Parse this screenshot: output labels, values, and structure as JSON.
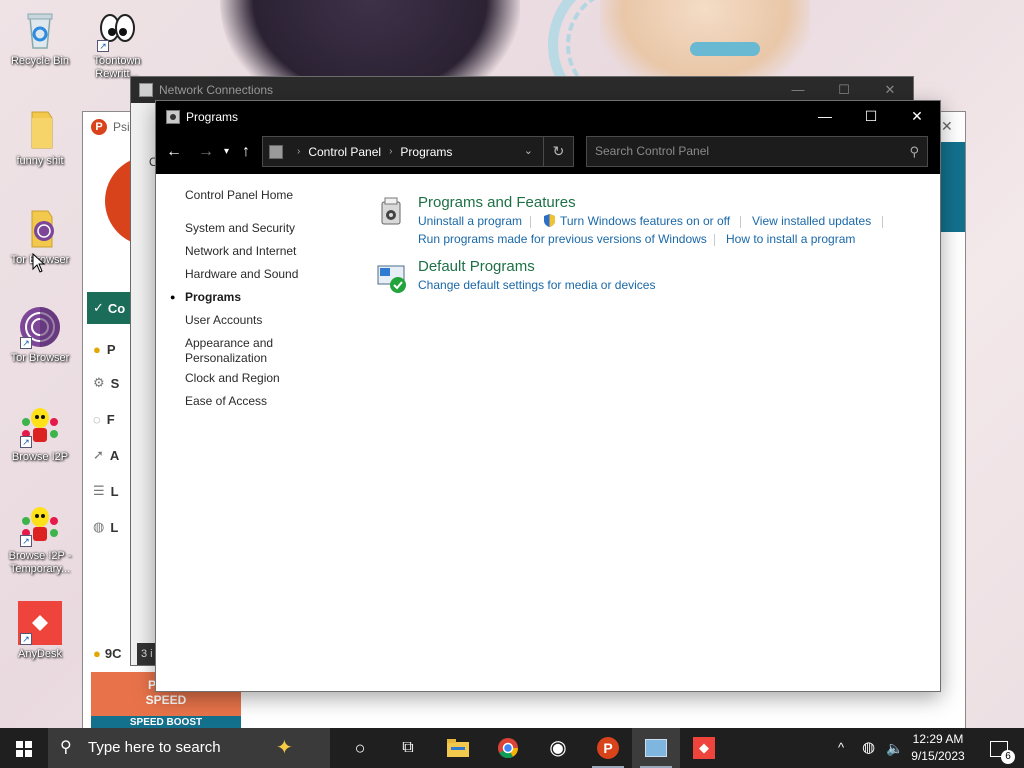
{
  "desktop": {
    "icons": [
      {
        "label": "Recycle Bin",
        "icon": "recycle-bin-icon"
      },
      {
        "label": "Toontown Rewritt...",
        "icon": "toontown-icon"
      },
      {
        "label": "funny shit",
        "icon": "folder-icon"
      },
      {
        "label": "Tor Browser",
        "icon": "tor-folder-icon"
      },
      {
        "label": "Tor Browser",
        "icon": "tor-browser-icon"
      },
      {
        "label": "Browse I2P",
        "icon": "i2p-icon"
      },
      {
        "label": "Browse I2P - Temporary...",
        "icon": "i2p-icon"
      },
      {
        "label": "AnyDesk",
        "icon": "anydesk-icon"
      }
    ]
  },
  "psiphon_window": {
    "title": "Psip",
    "sidebar_letters": [
      "Co",
      "P",
      "S",
      "F",
      "A",
      "L",
      "L"
    ],
    "bottom_count": "9C",
    "speed_label": "PSIPH SPEED",
    "speed_boost": "SPEED BOOST"
  },
  "network_window": {
    "title": "Network Connections",
    "status_fragment": "3 i",
    "left_fragment": "O"
  },
  "programs_window": {
    "title": "Programs",
    "address": {
      "root": "Control Panel",
      "current": "Programs"
    },
    "search_placeholder": "Search Control Panel",
    "left_nav": {
      "home": "Control Panel Home",
      "items": [
        {
          "label": "System and Security"
        },
        {
          "label": "Network and Internet"
        },
        {
          "label": "Hardware and Sound"
        },
        {
          "label": "Programs",
          "current": true
        },
        {
          "label": "User Accounts"
        },
        {
          "label": "Appearance and"
        },
        {
          "label": "Personalization"
        },
        {
          "label": "Clock and Region"
        },
        {
          "label": "Ease of Access"
        }
      ]
    },
    "categories": [
      {
        "title": "Programs and Features",
        "icon": "programs-features-icon",
        "links": [
          "Uninstall a program",
          "Turn Windows features on or off",
          "View installed updates",
          "Run programs made for previous versions of Windows",
          "How to install a program"
        ]
      },
      {
        "title": "Default Programs",
        "icon": "default-programs-icon",
        "links": [
          "Change default settings for media or devices"
        ]
      }
    ]
  },
  "taskbar": {
    "search_placeholder": "Type here to search",
    "time": "12:29 AM",
    "date": "9/15/2023",
    "notification_count": "6"
  },
  "colors": {
    "category_title": "#1e7145",
    "link": "#1a68a8",
    "taskbar": "#1f1f1f",
    "titlebar": "#000000"
  }
}
